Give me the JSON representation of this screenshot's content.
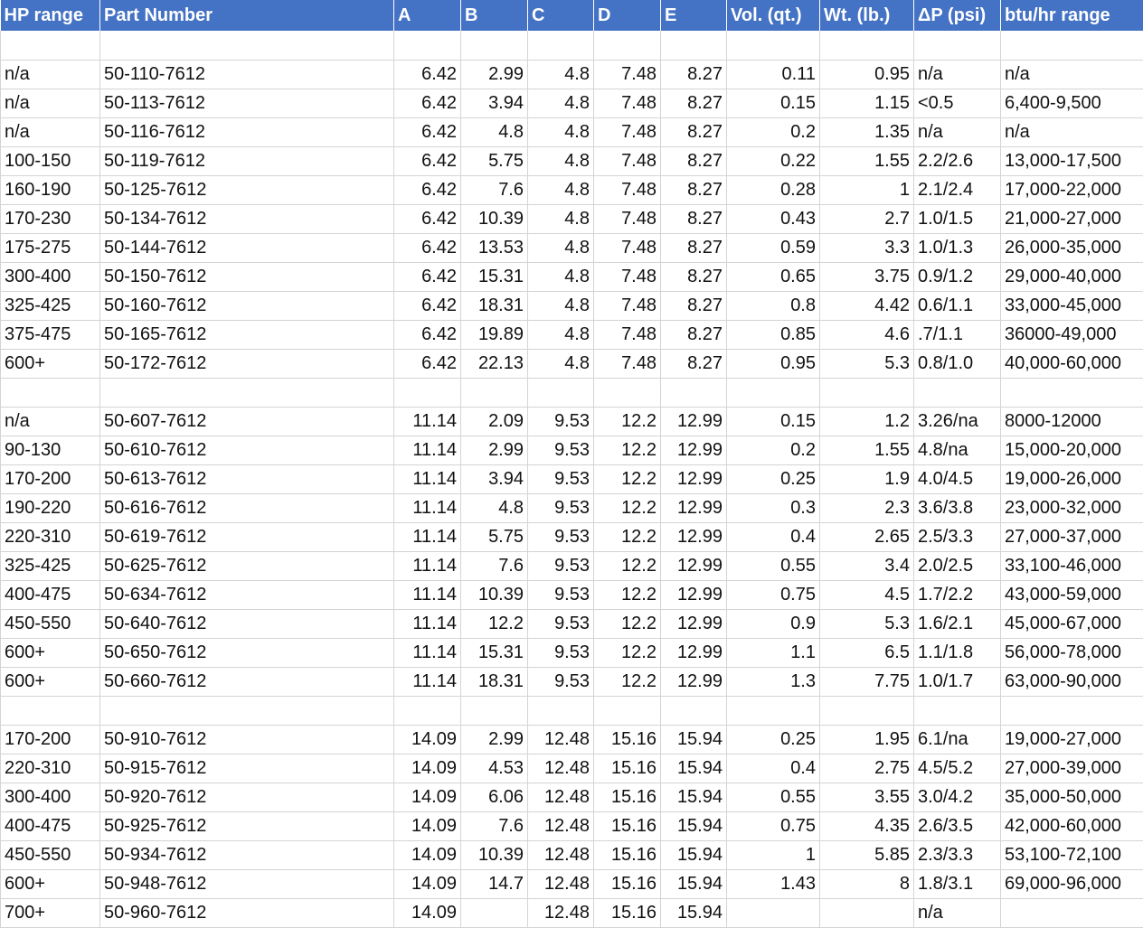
{
  "header": [
    "HP range",
    "Part Number",
    "A",
    "B",
    "C",
    "D",
    "E",
    "Vol. (qt.)",
    "Wt. (lb.)",
    "ΔP (psi)",
    "btu/hr range"
  ],
  "rows": [
    [
      "",
      "",
      "",
      "",
      "",
      "",
      "",
      "",
      "",
      "",
      ""
    ],
    [
      "n/a",
      "50-110-7612",
      "6.42",
      "2.99",
      "4.8",
      "7.48",
      "8.27",
      "0.11",
      "0.95",
      "n/a",
      "n/a"
    ],
    [
      "n/a",
      "50-113-7612",
      "6.42",
      "3.94",
      "4.8",
      "7.48",
      "8.27",
      "0.15",
      "1.15",
      "<0.5",
      "6,400-9,500"
    ],
    [
      "n/a",
      "50-116-7612",
      "6.42",
      "4.8",
      "4.8",
      "7.48",
      "8.27",
      "0.2",
      "1.35",
      "n/a",
      "n/a"
    ],
    [
      "100-150",
      "50-119-7612",
      "6.42",
      "5.75",
      "4.8",
      "7.48",
      "8.27",
      "0.22",
      "1.55",
      "2.2/2.6",
      "13,000-17,500"
    ],
    [
      "160-190",
      "50-125-7612",
      "6.42",
      "7.6",
      "4.8",
      "7.48",
      "8.27",
      "0.28",
      "1",
      "2.1/2.4",
      "17,000-22,000"
    ],
    [
      "170-230",
      "50-134-7612",
      "6.42",
      "10.39",
      "4.8",
      "7.48",
      "8.27",
      "0.43",
      "2.7",
      "1.0/1.5",
      "21,000-27,000"
    ],
    [
      "175-275",
      "50-144-7612",
      "6.42",
      "13.53",
      "4.8",
      "7.48",
      "8.27",
      "0.59",
      "3.3",
      "1.0/1.3",
      "26,000-35,000"
    ],
    [
      "300-400",
      "50-150-7612",
      "6.42",
      "15.31",
      "4.8",
      "7.48",
      "8.27",
      "0.65",
      "3.75",
      "0.9/1.2",
      "29,000-40,000"
    ],
    [
      "325-425",
      "50-160-7612",
      "6.42",
      "18.31",
      "4.8",
      "7.48",
      "8.27",
      "0.8",
      "4.42",
      "0.6/1.1",
      "33,000-45,000"
    ],
    [
      "375-475",
      "50-165-7612",
      "6.42",
      "19.89",
      "4.8",
      "7.48",
      "8.27",
      "0.85",
      "4.6",
      ".7/1.1",
      "36000-49,000"
    ],
    [
      "600+",
      "50-172-7612",
      "6.42",
      "22.13",
      "4.8",
      "7.48",
      "8.27",
      "0.95",
      "5.3",
      "0.8/1.0",
      "40,000-60,000"
    ],
    [
      "",
      "",
      "",
      "",
      "",
      "",
      "",
      "",
      "",
      "",
      ""
    ],
    [
      "n/a",
      "50-607-7612",
      "11.14",
      "2.09",
      "9.53",
      "12.2",
      "12.99",
      "0.15",
      "1.2",
      "3.26/na",
      "8000-12000"
    ],
    [
      "90-130",
      "50-610-7612",
      "11.14",
      "2.99",
      "9.53",
      "12.2",
      "12.99",
      "0.2",
      "1.55",
      "4.8/na",
      "15,000-20,000"
    ],
    [
      "170-200",
      "50-613-7612",
      "11.14",
      "3.94",
      "9.53",
      "12.2",
      "12.99",
      "0.25",
      "1.9",
      "4.0/4.5",
      "19,000-26,000"
    ],
    [
      "190-220",
      "50-616-7612",
      "11.14",
      "4.8",
      "9.53",
      "12.2",
      "12.99",
      "0.3",
      "2.3",
      "3.6/3.8",
      "23,000-32,000"
    ],
    [
      "220-310",
      "50-619-7612",
      "11.14",
      "5.75",
      "9.53",
      "12.2",
      "12.99",
      "0.4",
      "2.65",
      "2.5/3.3",
      "27,000-37,000"
    ],
    [
      "325-425",
      "50-625-7612",
      "11.14",
      "7.6",
      "9.53",
      "12.2",
      "12.99",
      "0.55",
      "3.4",
      "2.0/2.5",
      "33,100-46,000"
    ],
    [
      "400-475",
      "50-634-7612",
      "11.14",
      "10.39",
      "9.53",
      "12.2",
      "12.99",
      "0.75",
      "4.5",
      "1.7/2.2",
      "43,000-59,000"
    ],
    [
      "450-550",
      "50-640-7612",
      "11.14",
      "12.2",
      "9.53",
      "12.2",
      "12.99",
      "0.9",
      "5.3",
      "1.6/2.1",
      "45,000-67,000"
    ],
    [
      "600+",
      "50-650-7612",
      "11.14",
      "15.31",
      "9.53",
      "12.2",
      "12.99",
      "1.1",
      "6.5",
      "1.1/1.8",
      "56,000-78,000"
    ],
    [
      "600+",
      "50-660-7612",
      "11.14",
      "18.31",
      "9.53",
      "12.2",
      "12.99",
      "1.3",
      "7.75",
      "1.0/1.7",
      "63,000-90,000"
    ],
    [
      "",
      "",
      "",
      "",
      "",
      "",
      "",
      "",
      "",
      "",
      ""
    ],
    [
      "170-200",
      "50-910-7612",
      "14.09",
      "2.99",
      "12.48",
      "15.16",
      "15.94",
      "0.25",
      "1.95",
      "6.1/na",
      "19,000-27,000"
    ],
    [
      "220-310",
      "50-915-7612",
      "14.09",
      "4.53",
      "12.48",
      "15.16",
      "15.94",
      "0.4",
      "2.75",
      "4.5/5.2",
      "27,000-39,000"
    ],
    [
      "300-400",
      "50-920-7612",
      "14.09",
      "6.06",
      "12.48",
      "15.16",
      "15.94",
      "0.55",
      "3.55",
      "3.0/4.2",
      "35,000-50,000"
    ],
    [
      "400-475",
      "50-925-7612",
      "14.09",
      "7.6",
      "12.48",
      "15.16",
      "15.94",
      "0.75",
      "4.35",
      "2.6/3.5",
      "42,000-60,000"
    ],
    [
      "450-550",
      "50-934-7612",
      "14.09",
      "10.39",
      "12.48",
      "15.16",
      "15.94",
      "1",
      "5.85",
      "2.3/3.3",
      "53,100-72,100"
    ],
    [
      "600+",
      "50-948-7612",
      "14.09",
      "14.7",
      "12.48",
      "15.16",
      "15.94",
      "1.43",
      "8",
      "1.8/3.1",
      "69,000-96,000"
    ],
    [
      "700+",
      "50-960-7612",
      "14.09",
      "",
      "12.48",
      "15.16",
      "15.94",
      "",
      "",
      "n/a",
      ""
    ]
  ],
  "colors": {
    "header_bg": "#4472c4",
    "header_text": "#ffffff",
    "grid": "#d4d4d4"
  }
}
